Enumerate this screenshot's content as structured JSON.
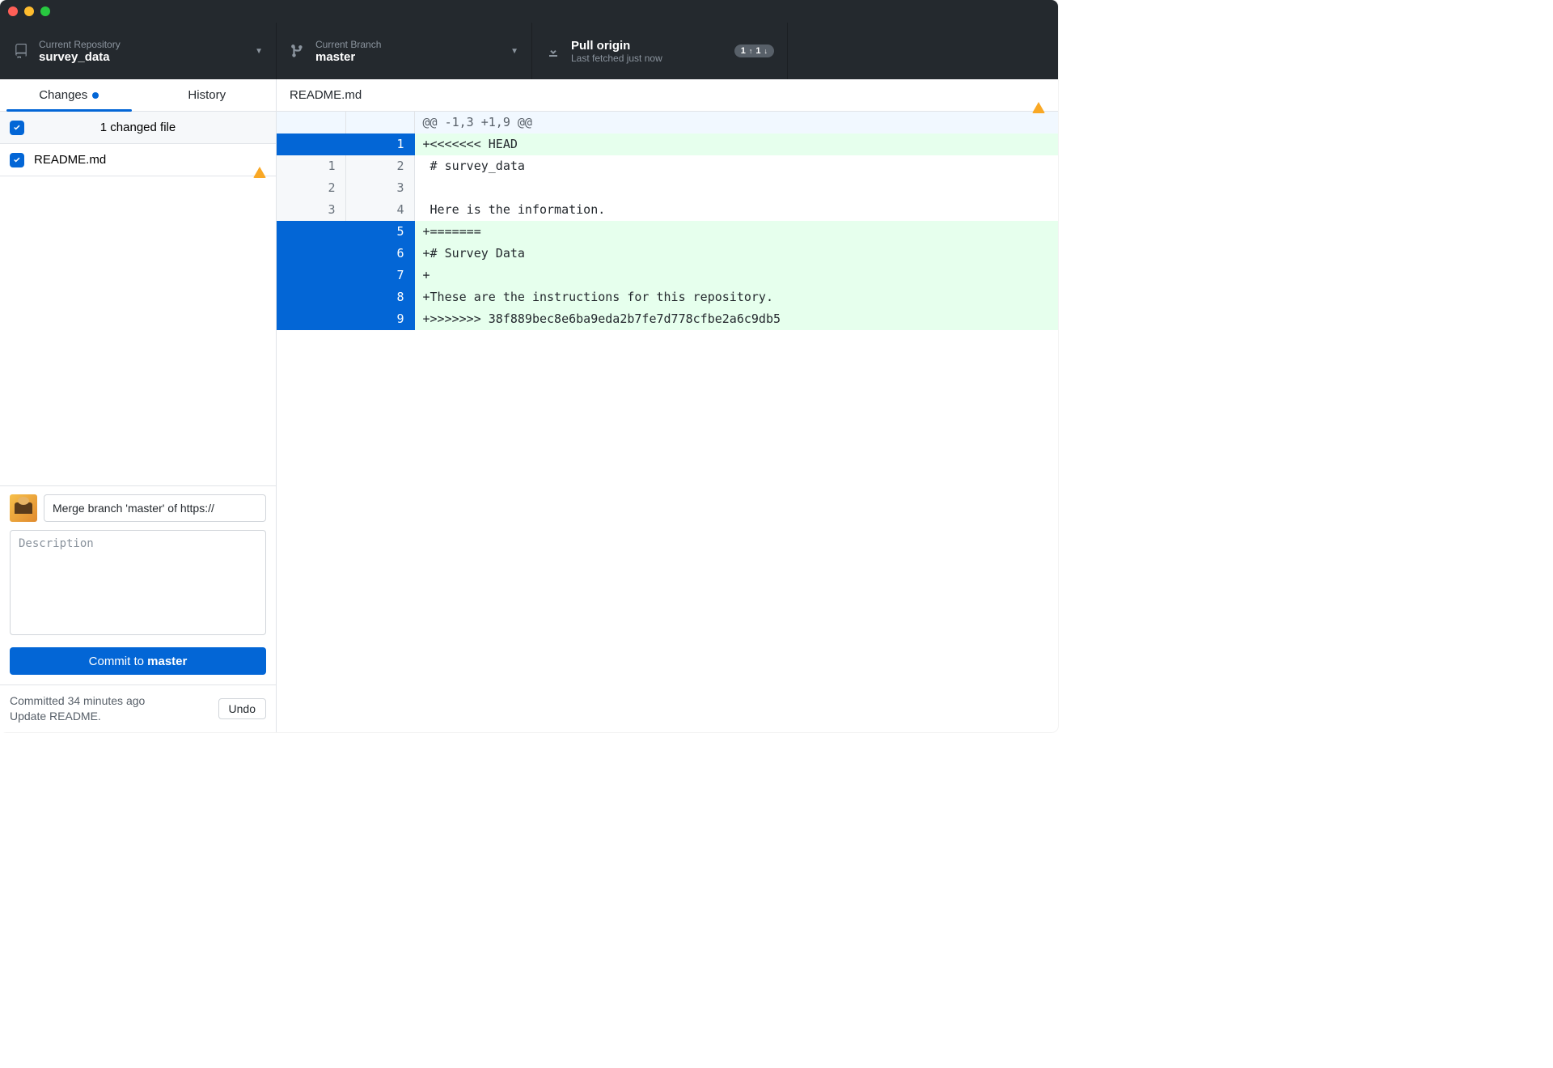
{
  "titlebar": {},
  "toolbar": {
    "repo": {
      "label": "Current Repository",
      "value": "survey_data"
    },
    "branch": {
      "label": "Current Branch",
      "value": "master"
    },
    "pull": {
      "label": "Pull origin",
      "sub": "Last fetched just now",
      "badge_up": "1",
      "badge_down": "1"
    }
  },
  "tabs": {
    "changes": "Changes",
    "history": "History"
  },
  "changes": {
    "header": "1 changed file",
    "files": [
      {
        "name": "README.md",
        "checked": true,
        "conflict": true
      }
    ]
  },
  "commit": {
    "summary_value": "Merge branch 'master' of https://",
    "description_placeholder": "Description",
    "button_prefix": "Commit to ",
    "button_branch": "master"
  },
  "status": {
    "line1": "Committed 34 minutes ago",
    "line2": "Update README.",
    "undo": "Undo"
  },
  "diff": {
    "filename": "README.md",
    "hunk": "@@ -1,3 +1,9 @@",
    "lines": [
      {
        "type": "add",
        "old": "",
        "new": "1",
        "text": "+<<<<<<< HEAD"
      },
      {
        "type": "ctx",
        "old": "1",
        "new": "2",
        "text": " # survey_data"
      },
      {
        "type": "ctx",
        "old": "2",
        "new": "3",
        "text": " "
      },
      {
        "type": "ctx",
        "old": "3",
        "new": "4",
        "text": " Here is the information."
      },
      {
        "type": "add",
        "old": "",
        "new": "5",
        "text": "+======="
      },
      {
        "type": "add",
        "old": "",
        "new": "6",
        "text": "+# Survey Data"
      },
      {
        "type": "add",
        "old": "",
        "new": "7",
        "text": "+"
      },
      {
        "type": "add",
        "old": "",
        "new": "8",
        "text": "+These are the instructions for this repository."
      },
      {
        "type": "add",
        "old": "",
        "new": "9",
        "text": "+>>>>>>> 38f889bec8e6ba9eda2b7fe7d778cfbe2a6c9db5"
      }
    ]
  }
}
